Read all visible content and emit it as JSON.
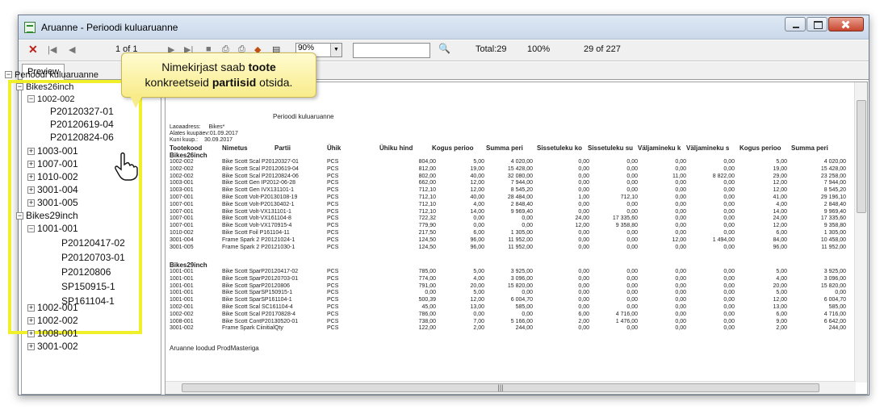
{
  "window": {
    "title": "Aruanne - Perioodi kuluaruanne"
  },
  "toolbar": {
    "page_of": "1 of 1",
    "zoom": "90%",
    "search_value": "",
    "total": "Total:29",
    "percent": "100%",
    "count": "29 of 227"
  },
  "tabs": {
    "preview": "Preview"
  },
  "callout": {
    "line1": "Nimekirjast saab ",
    "bold1": "toote",
    "line2a": "konkreetseid ",
    "bold2": "partiisid",
    "line2b": " otsida."
  },
  "tree": {
    "root": "Perioodi kuluaruanne",
    "g1": "Bikes26inch",
    "n1": "1002-002",
    "b1": "P20120327-01",
    "b2": "P20120619-04",
    "b3": "P20120824-06",
    "n2": "1003-001",
    "n3": "1007-001",
    "n4": "1010-002",
    "n5": "3001-004",
    "n6": "3001-005",
    "g2": "Bikes29inch",
    "m1": "1001-001",
    "c1": "P20120417-02",
    "c2": "P20120703-01",
    "c3": "P20120806",
    "c4": "SP150915-1",
    "c5": "SP161104-1",
    "m2": "1002-001",
    "m3": "1002-002",
    "m4": "1008-001",
    "m5": "3001-002"
  },
  "report": {
    "title": "Perioodi kuluaruanne",
    "addr_label": "Laoaadress:",
    "addr_value": "Bikes*",
    "from_label": "Alates kuupäev:",
    "from_value": "01.09.2017",
    "to_label": "Kuni kuup.:",
    "to_value": "30.09.2017",
    "columns": [
      "Tootekood",
      "Nimetus",
      "Partii",
      "Ühik",
      "Ühiku hind",
      "Kogus perioo",
      "Summa peri",
      "Sissetuleku ko",
      "Sissetuleku su",
      "Väljamineku k",
      "Väljamineku s",
      "Kogus perioo",
      "Summa peri"
    ],
    "group1": "Bikes26inch",
    "group2": "Bikes29inch",
    "footer": "Aruanne loodud ProdMasteriga",
    "rows1": [
      [
        "1002-002",
        "Bike Scott Scal P20120327-01",
        "PCS",
        "804,00",
        "5,00",
        "4 020,00",
        "0,00",
        "0,00",
        "0,00",
        "0,00",
        "5,00",
        "4 020,00"
      ],
      [
        "1002-002",
        "Bike Scott Scal P20120619-04",
        "PCS",
        "812,00",
        "19,00",
        "15 428,00",
        "0,00",
        "0,00",
        "0,00",
        "0,00",
        "19,00",
        "15 428,00"
      ],
      [
        "1002-002",
        "Bike Scott Scal P20120824-06",
        "PCS",
        "802,00",
        "40,00",
        "32 080,00",
        "0,00",
        "0,00",
        "11,00",
        "8 822,00",
        "29,00",
        "23 258,00"
      ],
      [
        "1003-001",
        "Bike Scott Gen IP2012-06-28",
        "PCS",
        "662,00",
        "12,00",
        "7 944,00",
        "0,00",
        "0,00",
        "0,00",
        "0,00",
        "12,00",
        "7 944,00"
      ],
      [
        "1003-001",
        "Bike Scott Gen IVX131101-1",
        "PCS",
        "712,10",
        "12,00",
        "8 545,20",
        "0,00",
        "0,00",
        "0,00",
        "0,00",
        "12,00",
        "8 545,20"
      ],
      [
        "1007-001",
        "Bike Scott Volt-P20130108-19",
        "PCS",
        "712,10",
        "40,00",
        "28 484,00",
        "1,00",
        "712,10",
        "0,00",
        "0,00",
        "41,00",
        "29 196,10"
      ],
      [
        "1007-001",
        "Bike Scott Volt-P20130402-1",
        "PCS",
        "712,10",
        "4,00",
        "2 848,40",
        "0,00",
        "0,00",
        "0,00",
        "0,00",
        "4,00",
        "2 848,40"
      ],
      [
        "1007-001",
        "Bike Scott Volt-VX131101-1",
        "PCS",
        "712,10",
        "14,00",
        "9 969,40",
        "0,00",
        "0,00",
        "0,00",
        "0,00",
        "14,00",
        "9 969,40"
      ],
      [
        "1007-001",
        "Bike Scott Volt-VX161104-8",
        "PCS",
        "722,32",
        "0,00",
        "0,00",
        "24,00",
        "17 335,60",
        "0,00",
        "0,00",
        "24,00",
        "17 335,60"
      ],
      [
        "1007-001",
        "Bike Scott Volt-VX170915-4",
        "PCS",
        "779,90",
        "0,00",
        "0,00",
        "12,00",
        "9 358,80",
        "0,00",
        "0,00",
        "12,00",
        "9 358,80"
      ],
      [
        "1010-002",
        "Bike Scott Foil P161104-11",
        "PCS",
        "217,50",
        "6,00",
        "1 305,00",
        "0,00",
        "0,00",
        "0,00",
        "0,00",
        "6,00",
        "1 305,00"
      ],
      [
        "3001-004",
        "Frame Spark 2 P20121024-1",
        "PCS",
        "124,50",
        "96,00",
        "11 952,00",
        "0,00",
        "0,00",
        "12,00",
        "1 494,00",
        "84,00",
        "10 458,00"
      ],
      [
        "3001-005",
        "Frame Spark 2 P20121030-1",
        "PCS",
        "124,50",
        "96,00",
        "11 952,00",
        "0,00",
        "0,00",
        "0,00",
        "0,00",
        "96,00",
        "11 952,00"
      ]
    ],
    "rows2": [
      [
        "1001-001",
        "Bike Scott SparP20120417-02",
        "PCS",
        "785,00",
        "5,00",
        "3 925,00",
        "0,00",
        "0,00",
        "0,00",
        "0,00",
        "5,00",
        "3 925,00"
      ],
      [
        "1001-001",
        "Bike Scott SparP20120703-01",
        "PCS",
        "774,00",
        "4,00",
        "3 096,00",
        "0,00",
        "0,00",
        "0,00",
        "0,00",
        "4,00",
        "3 096,00"
      ],
      [
        "1001-001",
        "Bike Scott SparP20120806",
        "PCS",
        "791,00",
        "20,00",
        "15 820,00",
        "0,00",
        "0,00",
        "0,00",
        "0,00",
        "20,00",
        "15 820,00"
      ],
      [
        "1001-001",
        "Bike Scott SparSP150915-1",
        "PCS",
        "0,00",
        "5,00",
        "0,00",
        "0,00",
        "0,00",
        "0,00",
        "0,00",
        "5,00",
        "0,00"
      ],
      [
        "1001-001",
        "Bike Scott SparSP161104-1",
        "PCS",
        "500,39",
        "12,00",
        "6 004,70",
        "0,00",
        "0,00",
        "0,00",
        "0,00",
        "12,00",
        "6 004,70"
      ],
      [
        "1002-001",
        "Bike Scott Scal SC161104-4",
        "PCS",
        "45,00",
        "13,00",
        "585,00",
        "0,00",
        "0,00",
        "0,00",
        "0,00",
        "13,00",
        "585,00"
      ],
      [
        "1002-002",
        "Bike Scott Scal P20170828-4",
        "PCS",
        "786,00",
        "0,00",
        "0,00",
        "6,00",
        "4 716,00",
        "0,00",
        "0,00",
        "6,00",
        "4 716,00"
      ],
      [
        "1008-001",
        "Bike Scott ContP20130520-01",
        "PCS",
        "738,00",
        "7,00",
        "5 166,00",
        "2,00",
        "1 476,00",
        "0,00",
        "0,00",
        "9,00",
        "6 642,00"
      ],
      [
        "3001-002",
        "Frame Spark CiinitialQty",
        "PCS",
        "122,00",
        "2,00",
        "244,00",
        "0,00",
        "0,00",
        "0,00",
        "0,00",
        "2,00",
        "244,00"
      ]
    ]
  },
  "colors": {
    "highlight": "#f0f02a",
    "callout_bg": "#f8ec8a",
    "close_x": "#c0201a"
  }
}
